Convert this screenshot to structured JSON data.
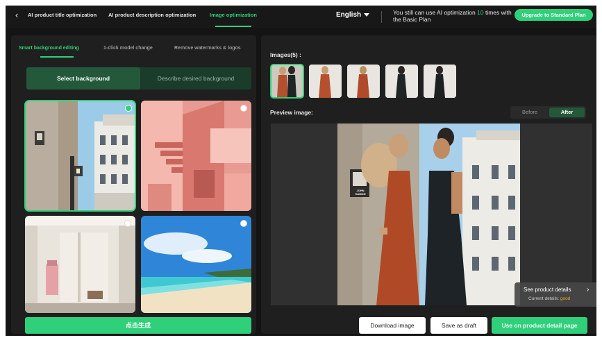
{
  "topbar": {
    "tabs": [
      {
        "label": "AI product title optimization"
      },
      {
        "label": "AI product description optimization"
      },
      {
        "label": "Image optimization",
        "active": true
      }
    ],
    "language": "English",
    "notice_prefix": "You still can use AI optimization ",
    "notice_count": "10",
    "notice_suffix": " times with the Basic Plan",
    "upgrade_label": "Upgrade to Standard Plan"
  },
  "left_panel": {
    "subtabs": [
      {
        "label": "Smart background editing",
        "active": true
      },
      {
        "label": "1-click model change"
      },
      {
        "label": "Remove watermarks & logos"
      }
    ],
    "segmented": {
      "selected": "Select background",
      "other": "Describe desired background"
    },
    "backgrounds": [
      {
        "name": "paris-street",
        "selected": true
      },
      {
        "name": "pink-architecture",
        "selected": false
      },
      {
        "name": "shop-interior",
        "selected": false
      },
      {
        "name": "beach",
        "selected": false
      }
    ],
    "generate_label": "点击生成"
  },
  "right_panel": {
    "images_label": "Images(5) :",
    "thumbnails": [
      {
        "name": "two-models",
        "selected": true
      },
      {
        "name": "red-dress-front",
        "selected": false
      },
      {
        "name": "red-dress-back",
        "selected": false
      },
      {
        "name": "black-dress-front",
        "selected": false
      },
      {
        "name": "black-dress-back",
        "selected": false
      }
    ],
    "preview_label": "Preview image:",
    "toggle": {
      "before": "Before",
      "after": "After",
      "active": "After"
    },
    "poster_text": "JOHN HAMON",
    "details": {
      "title": "See product details",
      "current_prefix": "Current details: ",
      "current_value": "good"
    },
    "buttons": {
      "download": "Download image",
      "draft": "Save as draft",
      "use": "Use on product detail page"
    }
  },
  "colors": {
    "accent": "#2fd07a",
    "panel": "#1f1f1f",
    "background": "#141414",
    "segment_active": "#23593a"
  }
}
